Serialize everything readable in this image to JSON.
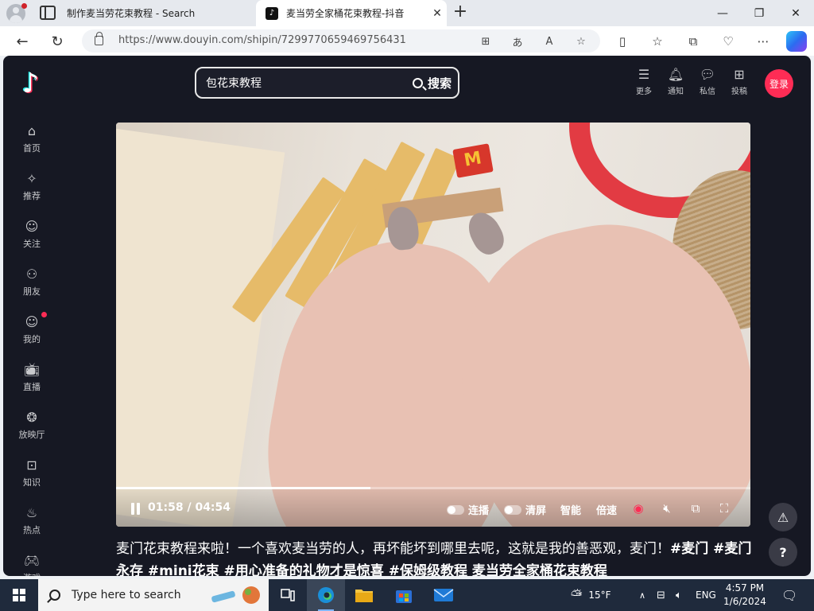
{
  "browser": {
    "tabs": [
      {
        "title": "制作麦当劳花束教程 - Search",
        "icon": "search-icon"
      },
      {
        "title": "麦当劳全家桶花束教程-抖音",
        "icon": "douyin-icon"
      }
    ],
    "url": "https://www.douyin.com/shipin/7299770659469756431"
  },
  "header": {
    "search_value": "包花束教程",
    "search_button": "搜索",
    "actions": [
      {
        "label": "更多",
        "icon": "menu-icon"
      },
      {
        "label": "通知",
        "icon": "bell-icon"
      },
      {
        "label": "私信",
        "icon": "message-icon"
      },
      {
        "label": "投稿",
        "icon": "upload-icon"
      }
    ],
    "login": "登录"
  },
  "sidebar": {
    "items": [
      {
        "label": "首页",
        "icon": "home-icon"
      },
      {
        "label": "推荐",
        "icon": "recommend-icon"
      },
      {
        "label": "关注",
        "icon": "follow-icon"
      },
      {
        "label": "朋友",
        "icon": "friends-icon"
      },
      {
        "label": "我的",
        "icon": "user-icon"
      },
      {
        "label": "直播",
        "icon": "live-icon"
      },
      {
        "label": "放映厅",
        "icon": "cinema-icon"
      },
      {
        "label": "知识",
        "icon": "knowledge-icon"
      },
      {
        "label": "热点",
        "icon": "hot-icon"
      },
      {
        "label": "游戏",
        "icon": "game-icon"
      }
    ]
  },
  "player": {
    "current_time": "01:58",
    "duration": "04:54",
    "progress_fraction": 0.401,
    "controls": [
      "连播",
      "清屏",
      "智能",
      "倍速"
    ]
  },
  "description": {
    "text": "麦门花束教程来啦！一个喜欢麦当劳的人，再坏能坏到哪里去呢，这就是我的善恶观，麦门！",
    "tags": "#麦门 #麦门永存 #mini花束 #用心准备的礼物才是惊喜 #保姆级教程",
    "tail": " 麦当劳全家桶花束教程"
  },
  "taskbar": {
    "search_placeholder": "Type here to search",
    "weather": "15°F",
    "language": "ENG",
    "time": "4:57 PM",
    "date": "1/6/2024"
  },
  "colors": {
    "accent": "#fe2c55",
    "page_bg": "#161823"
  }
}
